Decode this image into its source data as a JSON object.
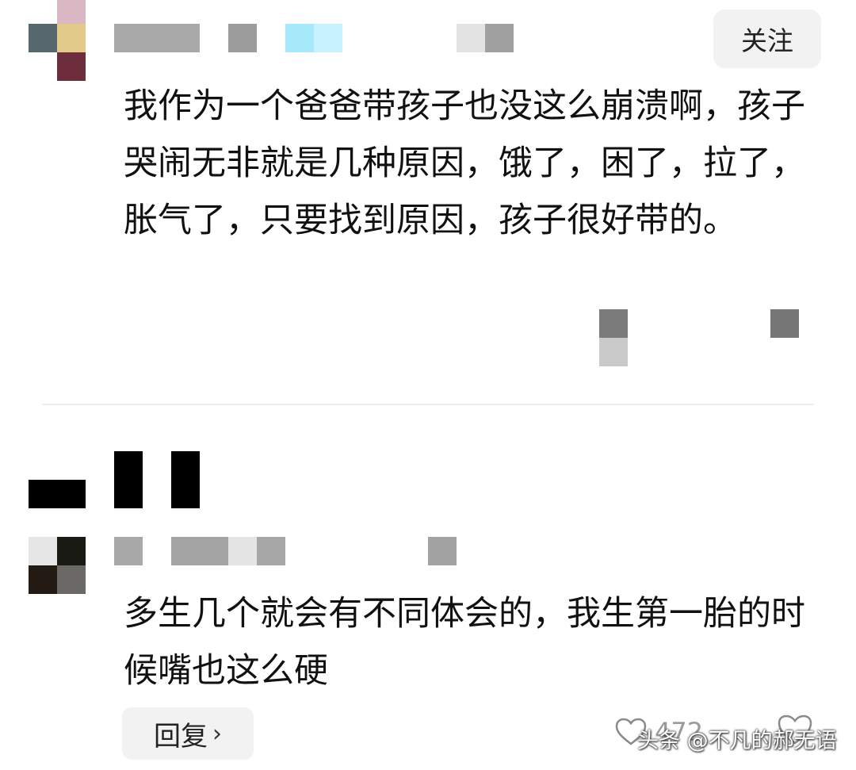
{
  "comment1": {
    "follow_label": "关注",
    "text": "我作为一个爸爸带孩子也没这么崩溃啊，孩子哭闹无非就是几种原因，饿了，困了，拉了，胀气了，只要找到原因，孩子很好带的。"
  },
  "comment2": {
    "text": "多生几个就会有不同体会的，我生第一胎的时候嘴也这么硬",
    "reply_label": "回复",
    "like_count": "472"
  },
  "watermark": "头条 @不凡的郝无语",
  "icons": {
    "follow": "none",
    "reply_chevron": "chevron-right-icon",
    "like": "heart-icon",
    "watermark_heart": "heart-icon"
  }
}
